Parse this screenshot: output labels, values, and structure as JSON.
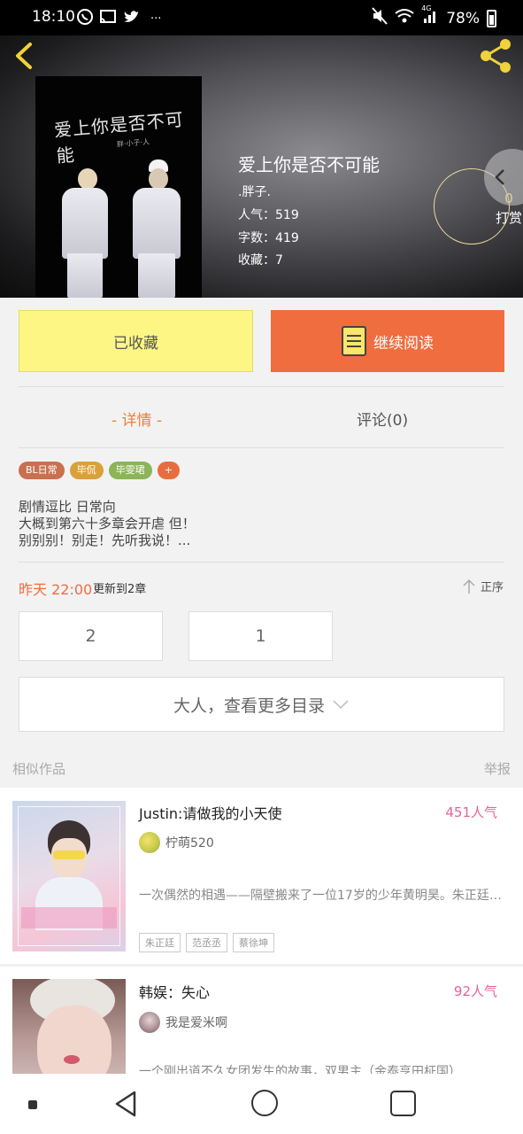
{
  "status_bar": {
    "time": "18:10",
    "dots": "···",
    "network": "4G",
    "battery": "78%"
  },
  "book": {
    "cover_title": "爱上你是否不可能",
    "cover_sub": "胖·小子·人",
    "title": "爱上你是否不可能",
    "author": ".胖子.",
    "popularity": "人气：519",
    "word_count": "字数：419",
    "favorites": "收藏：7",
    "tip_count": "0",
    "tip_label": "打赏"
  },
  "actions": {
    "favorited": "已收藏",
    "continue_reading": "继续阅读"
  },
  "tabs": {
    "detail": "- 详情 -",
    "comments": "评论(0)"
  },
  "tags": [
    {
      "label": "BL日常",
      "color": "#c9704f"
    },
    {
      "label": "毕侃",
      "color": "#d9a13a"
    },
    {
      "label": "毕雯珺",
      "color": "#8cb458"
    },
    {
      "label": "+",
      "color": "#e86d3e"
    }
  ],
  "description": [
    "剧情逗比 日常向",
    "大概到第六十多章会开虐 但！",
    "别别别！别走！先听我说！..."
  ],
  "update": {
    "time": "昨天 22:00",
    "text": "更新到2章",
    "order": "正序"
  },
  "chapters": [
    "2",
    "1"
  ],
  "more_catalog": "大人，查看更多目录",
  "similar": {
    "label": "相似作品",
    "report": "举报"
  },
  "list": [
    {
      "title": "Justin:请做我的小天使",
      "popularity": "451人气",
      "author": "柠萌520",
      "desc": "一次偶然的相遇——隔壁搬来了一位17岁的少年黄明昊。朱正廷……",
      "tags": [
        "朱正廷",
        "范丞丞",
        "蔡徐坤"
      ]
    },
    {
      "title": "韩娱：失心",
      "popularity": "92人气",
      "author": "我是爱米啊",
      "desc": "一个刚出道不久女团发生的故事，双男主（金泰亨田柾国）"
    }
  ],
  "colors": {
    "accent": "#ef6d3e",
    "favorite_bg": "#fdf684",
    "popularity": "#e8619a"
  }
}
